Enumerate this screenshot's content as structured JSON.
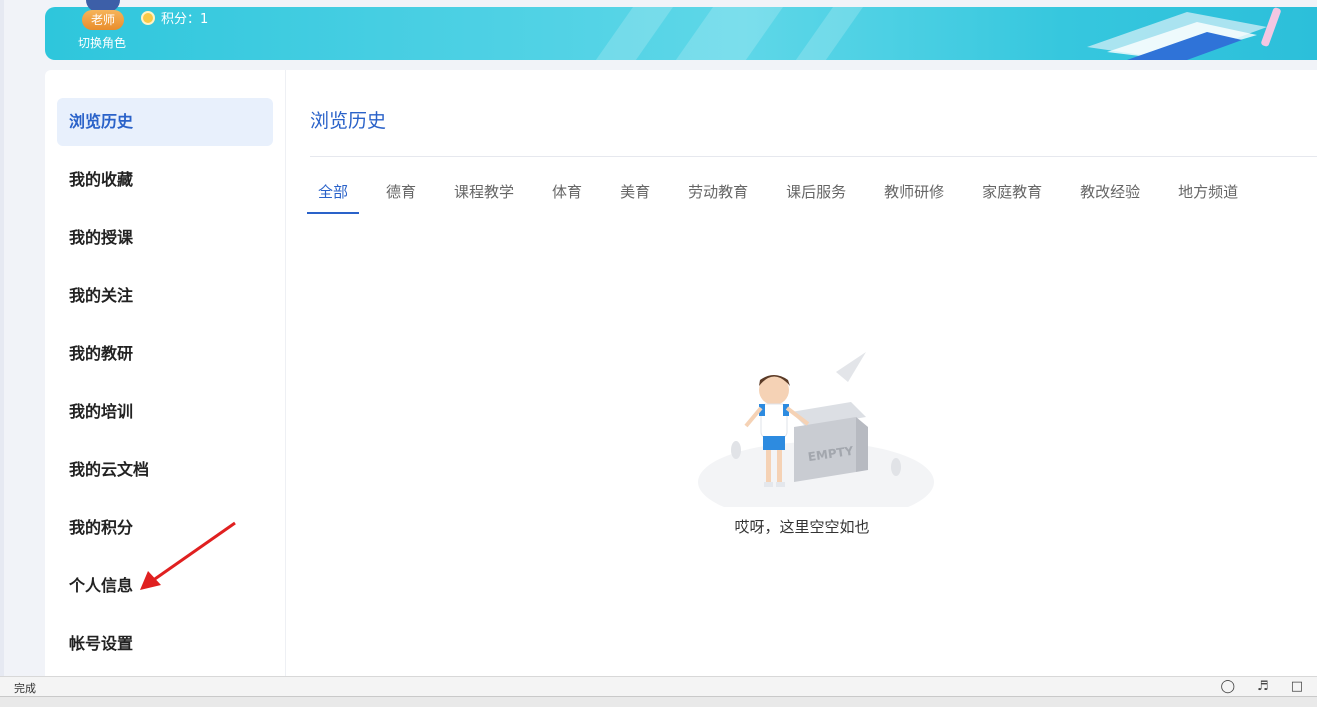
{
  "header": {
    "role_badge": "老师",
    "points_label": "积分：1",
    "switch_role": "切换角色"
  },
  "sidebar": {
    "items": [
      {
        "label": "浏览历史",
        "active": true
      },
      {
        "label": "我的收藏"
      },
      {
        "label": "我的授课"
      },
      {
        "label": "我的关注"
      },
      {
        "label": "我的教研"
      },
      {
        "label": "我的培训"
      },
      {
        "label": "我的云文档"
      },
      {
        "label": "我的积分"
      },
      {
        "label": "个人信息"
      },
      {
        "label": "帐号设置"
      }
    ]
  },
  "main": {
    "title": "浏览历史",
    "tabs": [
      {
        "label": "全部",
        "active": true
      },
      {
        "label": "德育"
      },
      {
        "label": "课程教学"
      },
      {
        "label": "体育"
      },
      {
        "label": "美育"
      },
      {
        "label": "劳动教育"
      },
      {
        "label": "课后服务"
      },
      {
        "label": "教师研修"
      },
      {
        "label": "家庭教育"
      },
      {
        "label": "教改经验"
      },
      {
        "label": "地方频道"
      }
    ],
    "empty_box_label": "EMPTY",
    "empty_text": "哎呀，这里空空如也"
  },
  "statusbar": {
    "status_text": "完成"
  },
  "colors": {
    "accent": "#2a62c9",
    "banner": "#3cc9df",
    "annotation_arrow": "#e02020"
  }
}
